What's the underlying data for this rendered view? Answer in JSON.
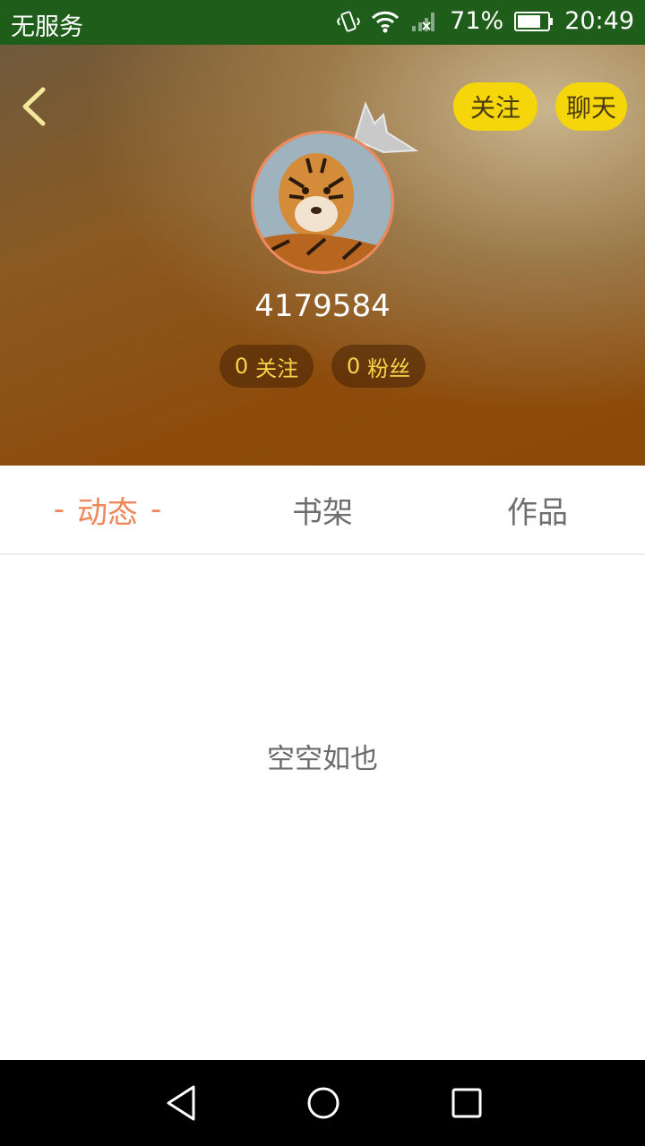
{
  "status_bar": {
    "carrier": "无服务",
    "battery": "71%",
    "time": "20:49"
  },
  "header": {
    "follow_label": "关注",
    "chat_label": "聊天",
    "user_id": "4179584",
    "following_count": "0",
    "following_label": "关注",
    "fans_count": "0",
    "fans_label": "粉丝"
  },
  "tabs": [
    {
      "label": "动态",
      "active": true
    },
    {
      "label": "书架",
      "active": false
    },
    {
      "label": "作品",
      "active": false
    }
  ],
  "empty_state": "空空如也",
  "colors": {
    "status_bar": "#1f5e1a",
    "accent": "#f0875a",
    "button_yellow": "#f5d60a",
    "count_text": "#f7d54a"
  }
}
